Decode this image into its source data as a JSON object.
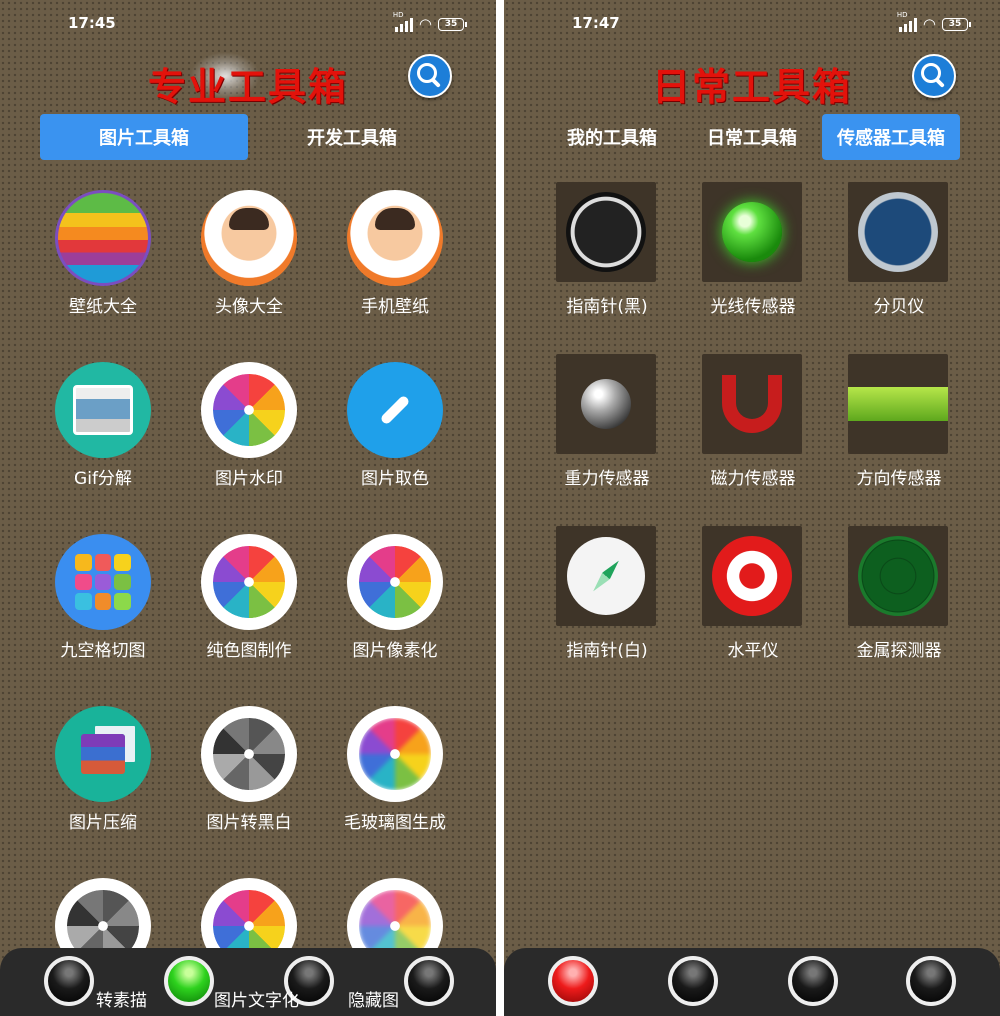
{
  "left": {
    "status_time": "17:45",
    "battery": "35",
    "title": "专业工具箱",
    "tabs": [
      {
        "label": "图片工具箱",
        "active": true
      },
      {
        "label": "开发工具箱",
        "active": false
      }
    ],
    "tools": [
      {
        "label": "壁纸大全",
        "icon": "apple-wallpaper-icon"
      },
      {
        "label": "头像大全",
        "icon": "avatar-icon"
      },
      {
        "label": "手机壁纸",
        "icon": "avatar-icon"
      },
      {
        "label": "Gif分解",
        "icon": "gif-icon"
      },
      {
        "label": "图片水印",
        "icon": "photos-flower-icon"
      },
      {
        "label": "图片取色",
        "icon": "eyedropper-icon"
      },
      {
        "label": "九空格切图",
        "icon": "grid-nine-icon"
      },
      {
        "label": "纯色图制作",
        "icon": "photos-flower-icon"
      },
      {
        "label": "图片像素化",
        "icon": "photos-flower-icon"
      },
      {
        "label": "图片压缩",
        "icon": "zip-archive-icon"
      },
      {
        "label": "图片转黑白",
        "icon": "photos-flower-gray-icon"
      },
      {
        "label": "毛玻璃图生成",
        "icon": "photos-flower-blur-icon"
      }
    ],
    "partial_labels": [
      "转素描",
      "图片文字化",
      "隐藏图"
    ],
    "bottom_balls": [
      "black",
      "green",
      "black",
      "black"
    ]
  },
  "right": {
    "status_time": "17:47",
    "battery": "35",
    "title": "日常工具箱",
    "tabs": [
      {
        "label": "我的工具箱",
        "active": false
      },
      {
        "label": "日常工具箱",
        "active": false
      },
      {
        "label": "传感器工具箱",
        "active": true
      }
    ],
    "tools": [
      {
        "label": "指南针(黑)",
        "icon": "compass-black-icon"
      },
      {
        "label": "光线传感器",
        "icon": "crystal-ball-icon"
      },
      {
        "label": "分贝仪",
        "icon": "gauge-icon"
      },
      {
        "label": "重力传感器",
        "icon": "metal-ball-icon"
      },
      {
        "label": "磁力传感器",
        "icon": "magnet-icon"
      },
      {
        "label": "方向传感器",
        "icon": "spirit-level-icon"
      },
      {
        "label": "指南针(白)",
        "icon": "compass-white-icon"
      },
      {
        "label": "水平仪",
        "icon": "target-icon"
      },
      {
        "label": "金属探测器",
        "icon": "radar-icon"
      }
    ],
    "bottom_balls": [
      "red",
      "black",
      "black",
      "black"
    ]
  }
}
